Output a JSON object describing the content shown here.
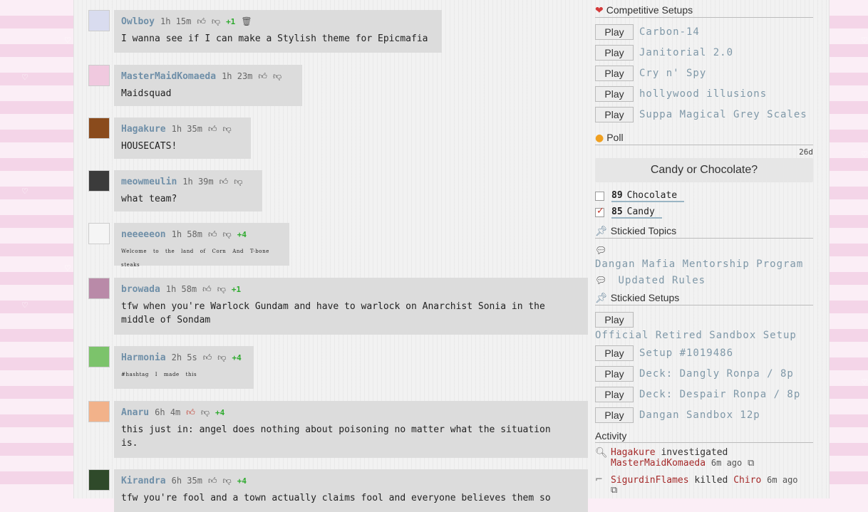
{
  "messages": [
    {
      "user": "Owlboy",
      "time": "1h 15m",
      "score": "+1",
      "text": "I wanna see if I can make a Stylish theme for Epicmafia",
      "trash": true,
      "avatar_color": "#d9dcef"
    },
    {
      "user": "MasterMaidKomaeda",
      "time": "1h 23m",
      "score": "",
      "text": "Maidsquad",
      "avatar_color": "#f0c9df"
    },
    {
      "user": "Hagakure",
      "time": "1h 35m",
      "score": "",
      "text": "HOUSECATS!",
      "avatar_color": "#8a4b1c"
    },
    {
      "user": "meowmeulin",
      "time": "1h 39m",
      "score": "",
      "text": "what team?",
      "avatar_color": "#3b3b3b"
    },
    {
      "user": "neeeeeon",
      "time": "1h 58m",
      "score": "+4",
      "text": "Welcome to the land of Corn And T-bone steaks",
      "avatar_color": "#f5f5f5"
    },
    {
      "user": "browada",
      "time": "1h 58m",
      "score": "+1",
      "text": "tfw when you're Warlock Gundam and have to warlock on Anarchist Sonia in the middle of Sondam",
      "avatar_color": "#b98aa8"
    },
    {
      "user": "Harmonia",
      "time": "2h 5s",
      "score": "+4",
      "text": "#hashtag I made this",
      "avatar_color": "#7cc36b"
    },
    {
      "user": "Anaru",
      "time": "6h 4m",
      "score": "+4",
      "text": "this just in: angel does nothing about poisoning no matter what the situation is.",
      "liked": true,
      "avatar_color": "#f2b28a"
    },
    {
      "user": "Kirandra",
      "time": "6h 35m",
      "score": "+4",
      "text": "tfw you're fool and a town actually claims fool and everyone believes them so",
      "avatar_color": "#2f4a2a"
    }
  ],
  "sidebar": {
    "competitive_title": "Competitive Setups",
    "play_label": "Play",
    "competitive": [
      "Carbon-14",
      "Janitorial 2.0",
      "Cry n' Spy",
      "hollywood illusions",
      "Suppa Magical Grey Scales"
    ],
    "poll_title": "Poll",
    "poll_age": "26d",
    "poll_question": "Candy or Chocolate?",
    "poll_options": [
      {
        "count": "89",
        "label": "Chocolate",
        "checked": false
      },
      {
        "count": "85",
        "label": "Candy",
        "checked": true
      }
    ],
    "stickied_topics_title": "Stickied Topics",
    "topics": [
      "Dangan Mafia Mentorship Program",
      "Updated Rules"
    ],
    "stickied_setups_title": "Stickied Setups",
    "official_setup": "Official Retired Sandbox Setup",
    "setups": [
      "Setup #1019486",
      "Deck: Dangly Ronpa / 8p",
      "Deck: Despair Ronpa / 8p",
      "Dangan Sandbox 12p"
    ],
    "activity_title": "Activity",
    "activity": [
      {
        "actor": "Hagakure",
        "verb": "investigated",
        "target": "MasterMaidKomaeda",
        "time": "6m ago"
      },
      {
        "actor": "SigurdinFlames",
        "verb": "killed",
        "target": "Chiro",
        "time": "6m ago"
      }
    ]
  },
  "colors": {
    "accent": "#7f98a8",
    "username": "#6f8fa8",
    "score": "#2eaa2e",
    "danger": "#c0392b"
  }
}
